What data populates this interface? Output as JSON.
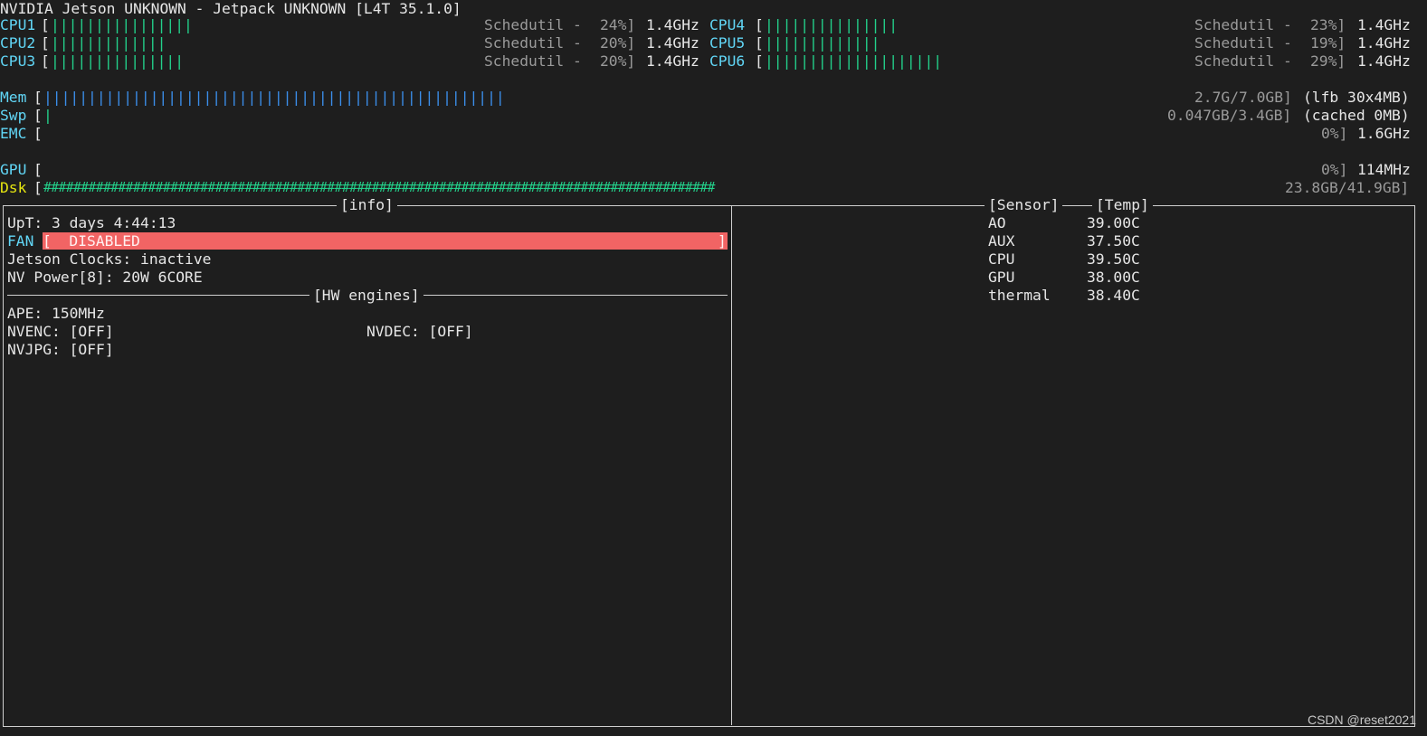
{
  "title": "NVIDIA Jetson UNKNOWN - Jetpack UNKNOWN [L4T 35.1.0]",
  "cpus": [
    {
      "label": "CPU1",
      "bars": "||||||||||||||||",
      "governor": "Schedutil -",
      "pct": "24%]",
      "freq": "1.4GHz"
    },
    {
      "label": "CPU2",
      "bars": "|||||||||||||",
      "governor": "Schedutil -",
      "pct": "20%]",
      "freq": "1.4GHz"
    },
    {
      "label": "CPU3",
      "bars": "|||||||||||||||",
      "governor": "Schedutil -",
      "pct": "20%]",
      "freq": "1.4GHz"
    },
    {
      "label": "CPU4",
      "bars": "|||||||||||||||",
      "governor": "Schedutil -",
      "pct": "23%]",
      "freq": "1.4GHz"
    },
    {
      "label": "CPU5",
      "bars": "|||||||||||||",
      "governor": "Schedutil -",
      "pct": "19%]",
      "freq": "1.4GHz"
    },
    {
      "label": "CPU6",
      "bars": "||||||||||||||||||||",
      "governor": "Schedutil -",
      "pct": "29%]",
      "freq": "1.4GHz"
    }
  ],
  "mem": {
    "label": "Mem",
    "bars": "||||||||||||||||||||||||||||||||||||||||||||||||||||",
    "value": "2.7G/7.0GB]",
    "extra": "(lfb 30x4MB)"
  },
  "swp": {
    "label": "Swp",
    "bars": "|",
    "value": "0.047GB/3.4GB]",
    "extra": "(cached 0MB)"
  },
  "emc": {
    "label": "EMC",
    "value": "0%]",
    "extra": "1.6GHz"
  },
  "gpu": {
    "label": "GPU",
    "value": "0%]",
    "extra": "114MHz"
  },
  "dsk": {
    "label": "Dsk",
    "bars": "##########################################################################################",
    "value": "23.8GB/41.9GB]"
  },
  "info": {
    "header": "[info]",
    "uptime": "UpT: 3 days 4:44:13",
    "fan_label": "FAN",
    "fan_value": "[  DISABLED",
    "fan_end": "]",
    "jetson_clocks": "Jetson Clocks: inactive",
    "nv_power": "NV Power[8]: 20W 6CORE",
    "hw_header": "[HW engines]",
    "ape": "APE: 150MHz",
    "nvenc": "NVENC: [OFF]",
    "nvdec": "NVDEC: [OFF]",
    "nvjpg": "NVJPG: [OFF]"
  },
  "sensors": {
    "header_sensor": "[Sensor]",
    "header_temp": "[Temp]",
    "rows": [
      {
        "name": "AO",
        "temp": "39.00C"
      },
      {
        "name": "AUX",
        "temp": "37.50C"
      },
      {
        "name": "CPU",
        "temp": "39.50C"
      },
      {
        "name": "GPU",
        "temp": "38.00C"
      },
      {
        "name": "thermal",
        "temp": "38.40C"
      }
    ]
  },
  "watermark": "CSDN @reset2021",
  "colors": {
    "label": "#61d6f6",
    "bar": "#23d18b",
    "fan": "#f16464",
    "disk_label": "#e5e510"
  }
}
